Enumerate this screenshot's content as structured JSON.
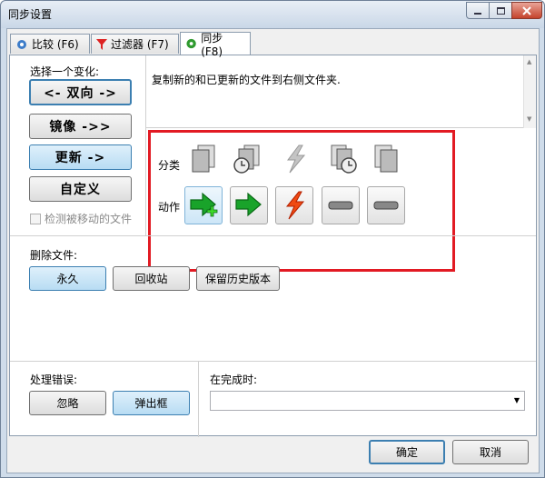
{
  "window": {
    "title": "同步设置"
  },
  "tabs": [
    {
      "label": "比较 (F6)",
      "icon": "gear-blue-icon"
    },
    {
      "label": "过滤器 (F7)",
      "icon": "filter-red-icon"
    },
    {
      "label": "同步 (F8)",
      "icon": "gear-green-icon"
    }
  ],
  "variant": {
    "heading": "选择一个变化:",
    "buttons": [
      "<- 双向 ->",
      "镜像 ->>",
      "更新 ->",
      "自定义"
    ],
    "selected": "更新 ->",
    "detect_moved_label": "检测被移动的文件"
  },
  "description": "复制新的和已更新的文件到右侧文件夹.",
  "categories": {
    "category_label": "分类",
    "action_label": "动作",
    "category_icons": [
      "file-left-only-icon",
      "file-left-newer-icon",
      "file-conflict-icon",
      "file-right-newer-icon",
      "file-right-only-icon"
    ],
    "action_icons": [
      "copy-create-right-icon",
      "copy-update-right-icon",
      "conflict-lightning-icon",
      "do-nothing-icon",
      "do-nothing-icon"
    ]
  },
  "deletion": {
    "heading": "删除文件:",
    "buttons": [
      "永久",
      "回收站",
      "保留历史版本"
    ],
    "selected": "永久"
  },
  "errors": {
    "heading": "处理错误:",
    "buttons": [
      "忽略",
      "弹出框"
    ],
    "selected": "弹出框"
  },
  "on_completion": {
    "heading": "在完成时:",
    "value": ""
  },
  "footer": {
    "ok": "确定",
    "cancel": "取消"
  },
  "colors": {
    "highlight_red": "#e21a23",
    "accent_blue": "#3c7fb1"
  }
}
